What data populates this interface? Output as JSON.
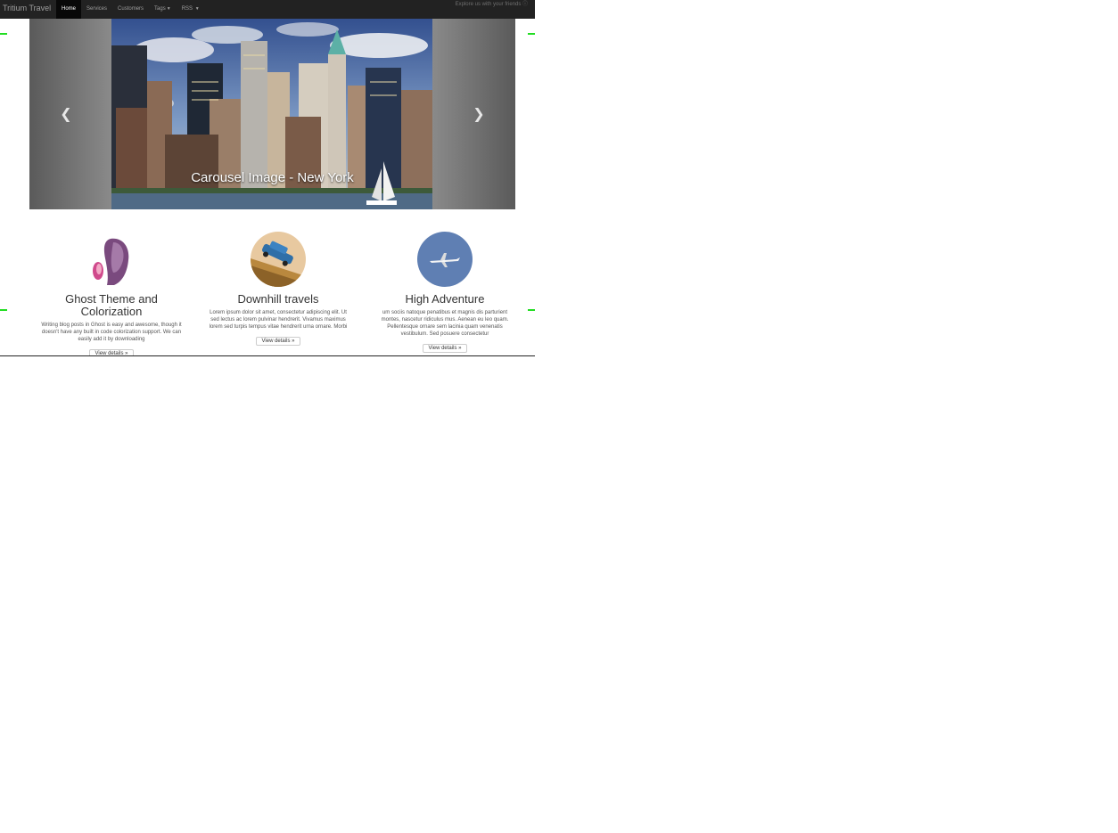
{
  "navbar": {
    "brand": "Tritium Travel",
    "items": [
      {
        "label": "Home",
        "active": true
      },
      {
        "label": "Services",
        "active": false
      },
      {
        "label": "Customers",
        "active": false
      },
      {
        "label": "Tags",
        "active": false,
        "dropdown": true
      },
      {
        "label": "RSS",
        "active": false,
        "dropdown": true
      }
    ],
    "right_text": "Explore us with your friends ⓘ"
  },
  "carousel": {
    "caption": "Carousel Image - New York",
    "prev_icon": "chevron-left",
    "next_icon": "chevron-right"
  },
  "features": [
    {
      "title": "Ghost Theme and Colorization",
      "text": "Writing blog posts in Ghost is easy and awesome, though it doesn't have any built in code colorization support. We can easily add it by downloading",
      "button": "View details »"
    },
    {
      "title": "Downhill travels",
      "text": "Lorem ipsum dolor sit amet, consectetur adipiscing elit. Ut sed lectus ac lorem pulvinar hendrerit. Vivamus maximus lorem sed turpis tempus vitae hendrerit urna ornare. Morbi",
      "button": "View details »"
    },
    {
      "title": "High Adventure",
      "text": "um sociis natoque penatibus et magnis dis parturient montes, nascetur ridiculus mus. Aenean eu leo quam. Pellentesque ornare sem lacinia quam venenatis vestibulum. Sed posuere consectetur",
      "button": "View details »"
    }
  ],
  "colors": {
    "navbar_bg": "#222222",
    "navbar_active_bg": "#080808",
    "marker": "#22dd22"
  }
}
